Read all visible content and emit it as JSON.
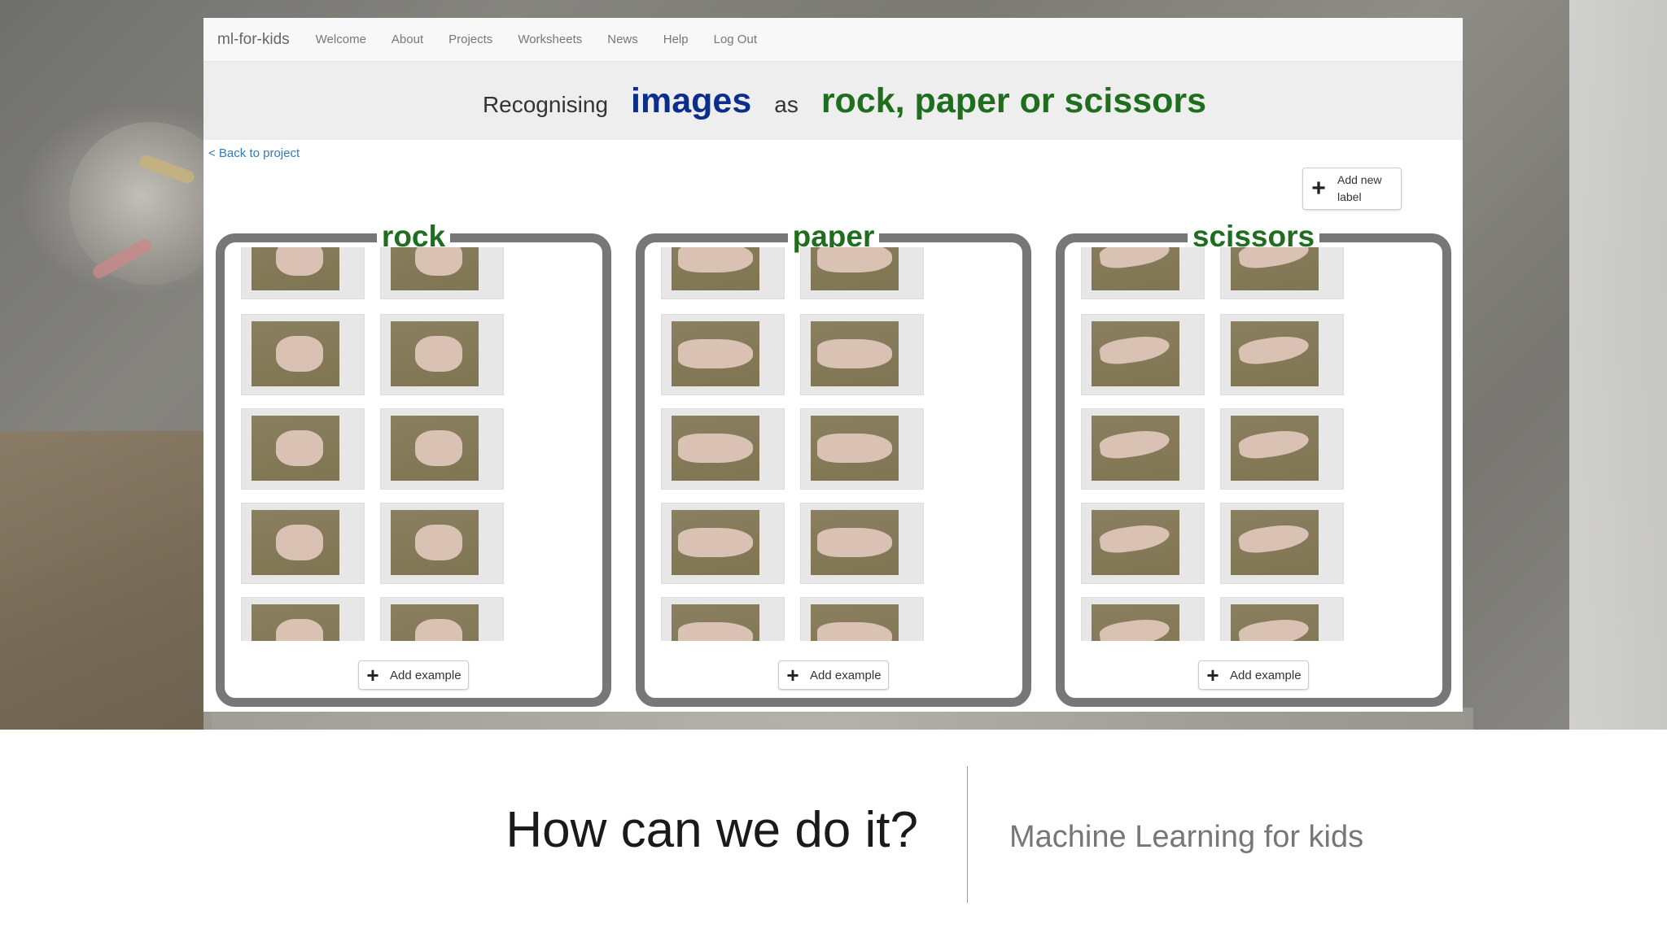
{
  "navbar": {
    "brand": "ml-for-kids",
    "links": [
      "Welcome",
      "About",
      "Projects",
      "Worksheets",
      "News",
      "Help",
      "Log Out"
    ]
  },
  "heading": {
    "prefix": "Recognising",
    "type": "images",
    "connector": "as",
    "labels": "rock, paper or scissors"
  },
  "back_link": "< Back to project",
  "add_label_button": "Add new label",
  "buckets": [
    {
      "name": "rock",
      "add_button": "Add example"
    },
    {
      "name": "paper",
      "add_button": "Add example"
    },
    {
      "name": "scissors",
      "add_button": "Add example"
    }
  ],
  "caption": {
    "title": "How can we do it?",
    "subtitle": "Machine Learning for kids"
  }
}
